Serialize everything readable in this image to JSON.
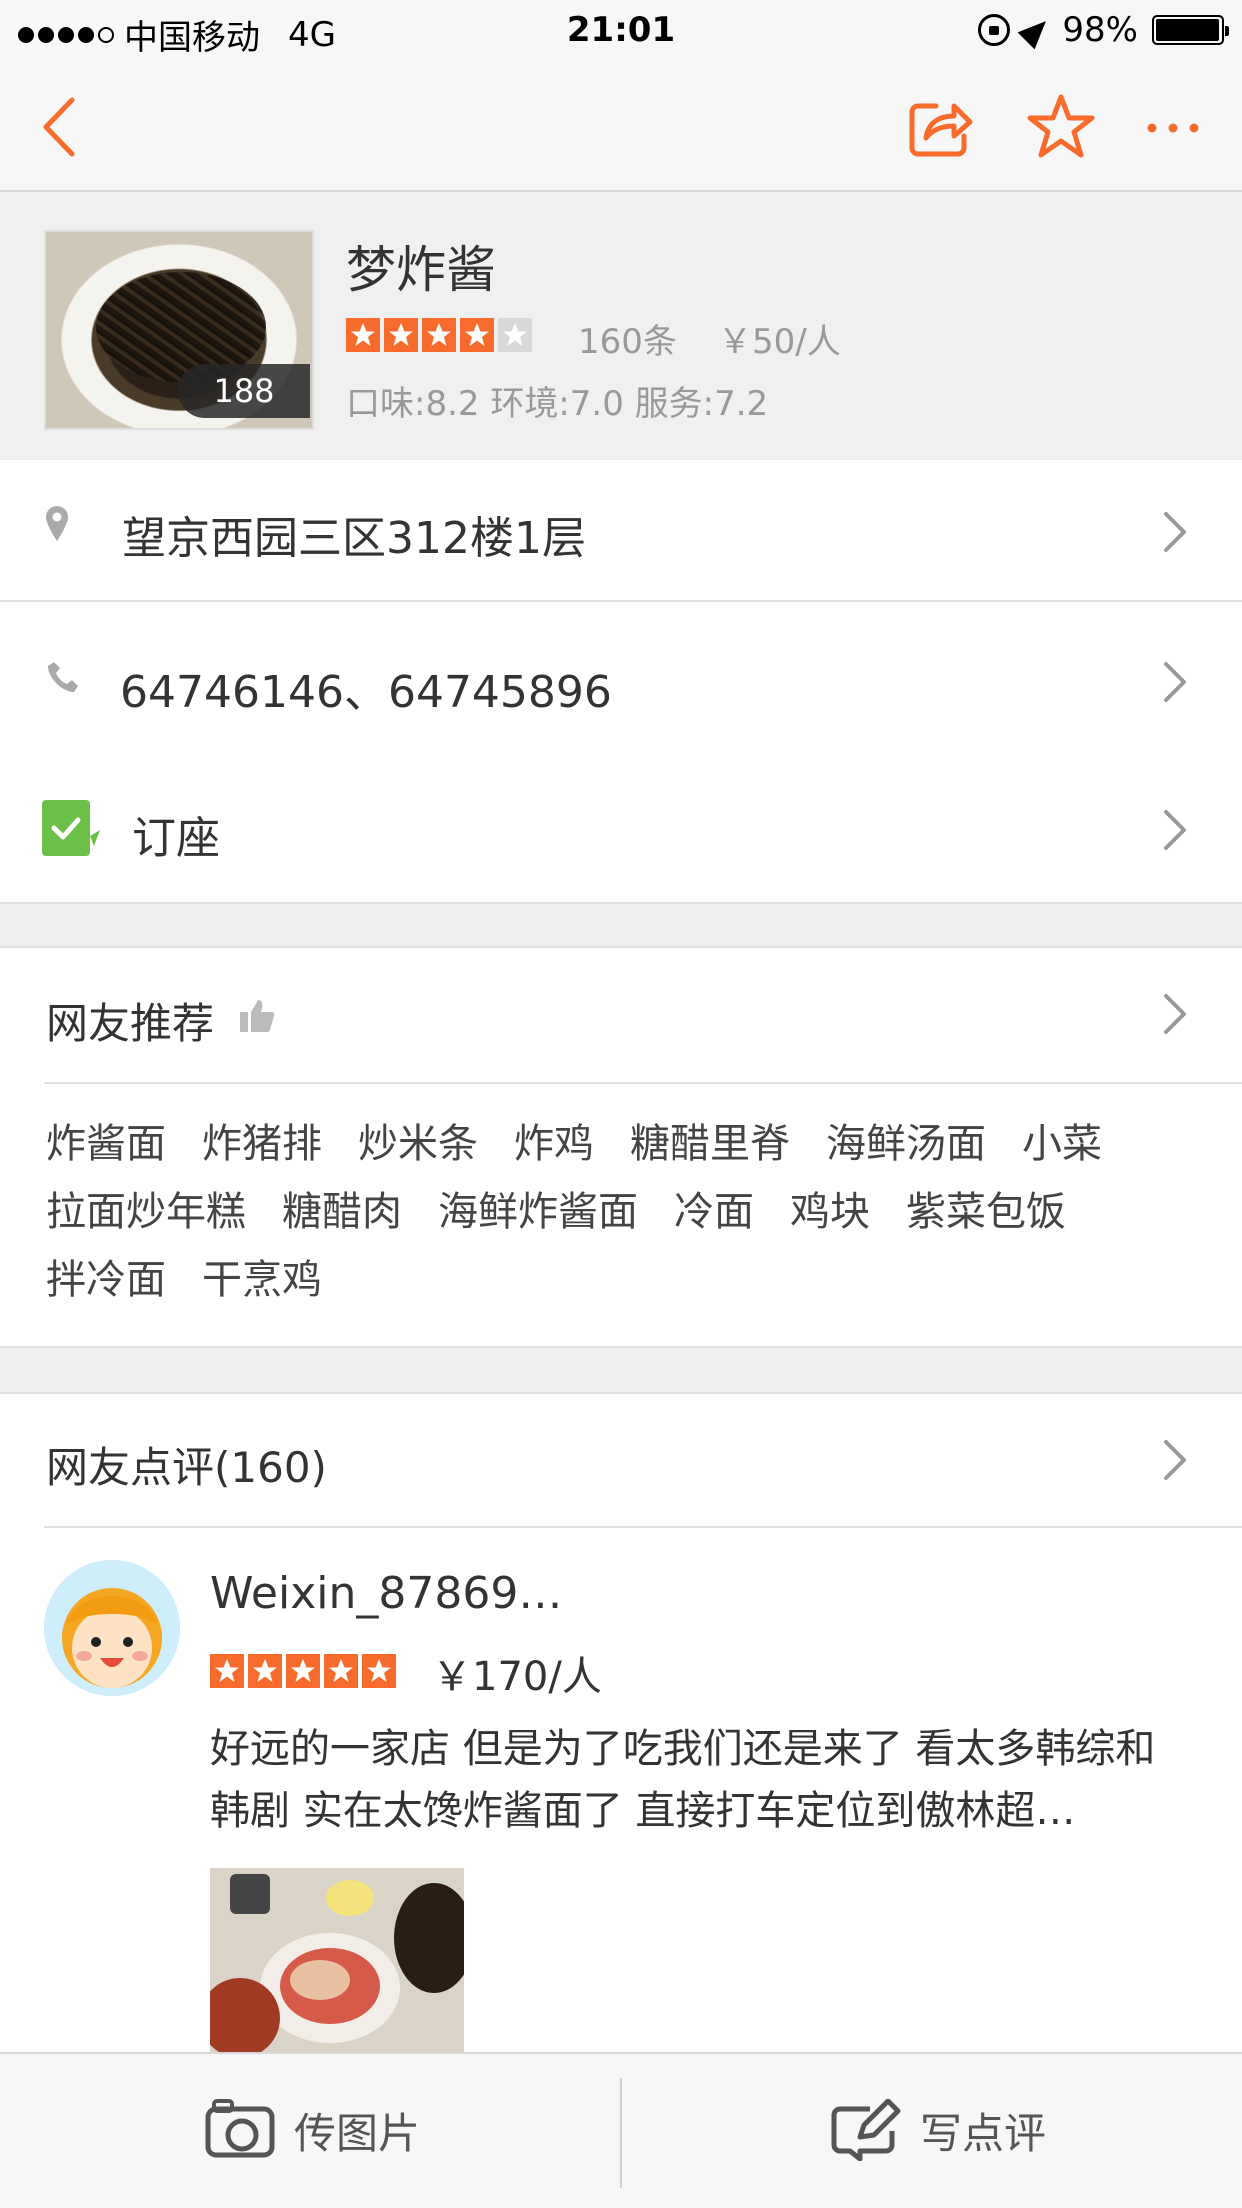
{
  "status_bar": {
    "carrier": "中国移动",
    "network": "4G",
    "time": "21:01",
    "battery": "98%",
    "battery_level": 0.98
  },
  "nav": {
    "icons": [
      "back-icon",
      "share-icon",
      "star-icon",
      "more-icon"
    ],
    "accent_color": "#f76b2c"
  },
  "shop": {
    "name": "梦炸酱",
    "photo_count": "188",
    "rating_stars": 4,
    "review_count": "160条",
    "price_per_person": "￥50/人",
    "scores": "口味:8.2  环境:7.0  服务:7.2"
  },
  "info": {
    "address": "望京西园三区312楼1层",
    "phone": "64746146、64745896",
    "booking": "订座"
  },
  "recommend": {
    "title": "网友推荐",
    "tags": [
      "炸酱面",
      "炸猪排",
      "炒米条",
      "炸鸡",
      "糖醋里脊",
      "海鲜汤面",
      "小菜",
      "拉面炒年糕",
      "糖醋肉",
      "海鲜炸酱面",
      "冷面",
      "鸡块",
      "紫菜包饭",
      "拌冷面",
      "干烹鸡"
    ]
  },
  "reviews": {
    "title": "网友点评(160)",
    "items": [
      {
        "user": "Weixin_87869…",
        "rating_stars": 5,
        "price": "￥170/人",
        "text": "好远的一家店 但是为了吃我们还是来了 看太多韩综和韩剧 实在太馋炸酱面了 直接打车定位到傲林超…"
      }
    ]
  },
  "bottom_bar": {
    "upload_photo": "传图片",
    "write_review": "写点评"
  }
}
